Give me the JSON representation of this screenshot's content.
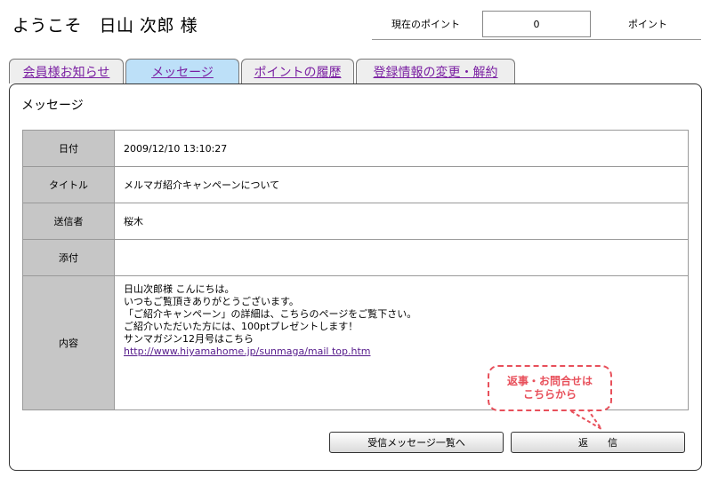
{
  "header": {
    "greeting": "ようこそ　日山 次郎 様",
    "points_label": "現在のポイント",
    "points_value": "0",
    "points_unit": "ポイント"
  },
  "tabs": [
    {
      "label": "会員様お知らせ",
      "active": false
    },
    {
      "label": "メッセージ",
      "active": true
    },
    {
      "label": "ポイントの履歴",
      "active": false
    },
    {
      "label": "登録情報の変更・解約",
      "active": false
    }
  ],
  "panel": {
    "title": "メッセージ"
  },
  "message": {
    "date_label": "日付",
    "date_value": "2009/12/10 13:10:27",
    "title_label": "タイトル",
    "title_value": "メルマガ紹介キャンペーンについて",
    "sender_label": "送信者",
    "sender_value": "桜木",
    "attach_label": "添付",
    "attach_value": "",
    "body_label": "内容",
    "body_lines": [
      "日山次郎様 こんにちは。",
      "いつもご覧頂きありがとうございます。",
      "「ご紹介キャンペーン」の詳細は、こちらのページをご覧下さい。",
      "ご紹介いただいた方には、100ptプレゼントします！",
      "",
      "サンマガジン12月号はこちら"
    ],
    "body_link": "http://www.hiyamahome.jp/sunmaga/mail top.htm"
  },
  "callout": {
    "line1": "返事・お問合せは",
    "line2": "こちらから"
  },
  "buttons": {
    "list": "受信メッセージ一覧へ",
    "reply": "返　　信"
  }
}
